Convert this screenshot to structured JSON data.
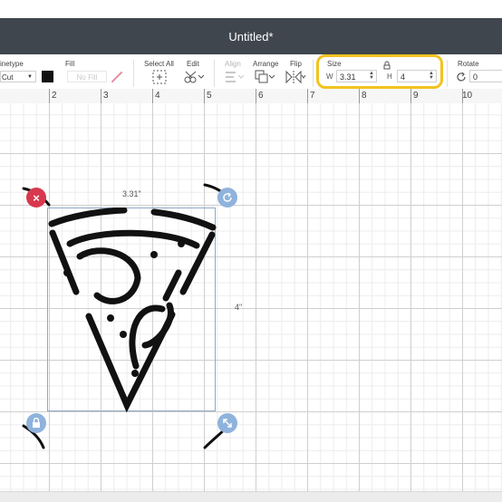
{
  "title": "Untitled*",
  "toolbar": {
    "linetype_label": "inetype",
    "linetype_value": "Cut",
    "fill_label": "Fill",
    "fill_value": "No Fill",
    "select_all_label": "Select All",
    "edit_label": "Edit",
    "align_label": "Align",
    "arrange_label": "Arrange",
    "flip_label": "Flip",
    "size_label": "Size",
    "w_label": "W",
    "w_value": "3.31",
    "h_label": "H",
    "h_value": "4",
    "rotate_label": "Rotate",
    "rotate_value": "0"
  },
  "ruler": {
    "numbers": [
      "2",
      "3",
      "4",
      "5",
      "6",
      "7",
      "8",
      "9",
      "10"
    ]
  },
  "selection": {
    "width_label": "3.31\"",
    "height_label": "4\""
  },
  "colors": {
    "titlebar": "#3f464e",
    "highlight": "#f2c31f",
    "delete_handle": "#d8384d",
    "handle": "#8fb3dc"
  },
  "icons": [
    "delete-icon",
    "rotate-icon",
    "lock-icon",
    "scale-icon",
    "pen-icon",
    "select-all-icon",
    "edit-icon",
    "align-icon",
    "arrange-icon",
    "flip-icon",
    "lock-aspect-icon",
    "rotate-tool-icon"
  ]
}
